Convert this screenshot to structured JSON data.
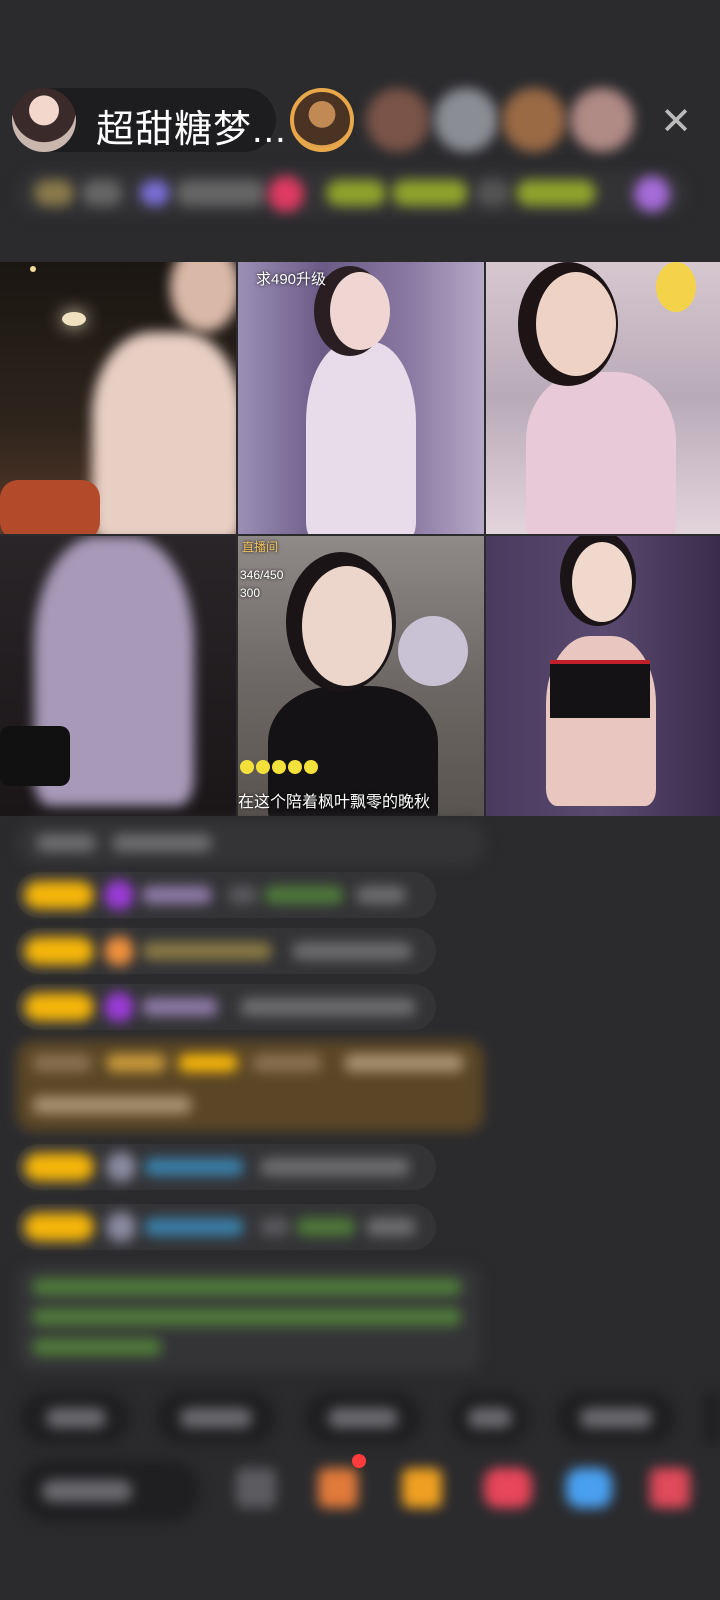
{
  "header": {
    "host_name": "超甜糖梦...",
    "viewer_avatars": [
      "viewer-1",
      "viewer-2",
      "viewer-3",
      "viewer-4",
      "viewer-5"
    ],
    "close_icon": "close-icon"
  },
  "grid": {
    "tiles": [
      {
        "caption": ""
      },
      {
        "caption": "求490升级"
      },
      {
        "caption": ""
      },
      {
        "caption": ""
      },
      {
        "caption_top": "直播间",
        "caption_mid1": "346/450",
        "caption_mid2": "300",
        "caption": "在这个陪着枫叶飘零的晚秋"
      },
      {
        "caption": ""
      }
    ]
  },
  "colors": {
    "background": "#2b2b2e",
    "badge": "#f5b50a",
    "gem_purple": "#9b3bd8",
    "gem_orange": "#f0913c",
    "green_text": "#7fc25a",
    "blue_text": "#3aa3d8"
  },
  "icons": [
    "close-icon",
    "gift-icon",
    "fan-icon",
    "game-icon",
    "blue-icon",
    "red-icon"
  ]
}
